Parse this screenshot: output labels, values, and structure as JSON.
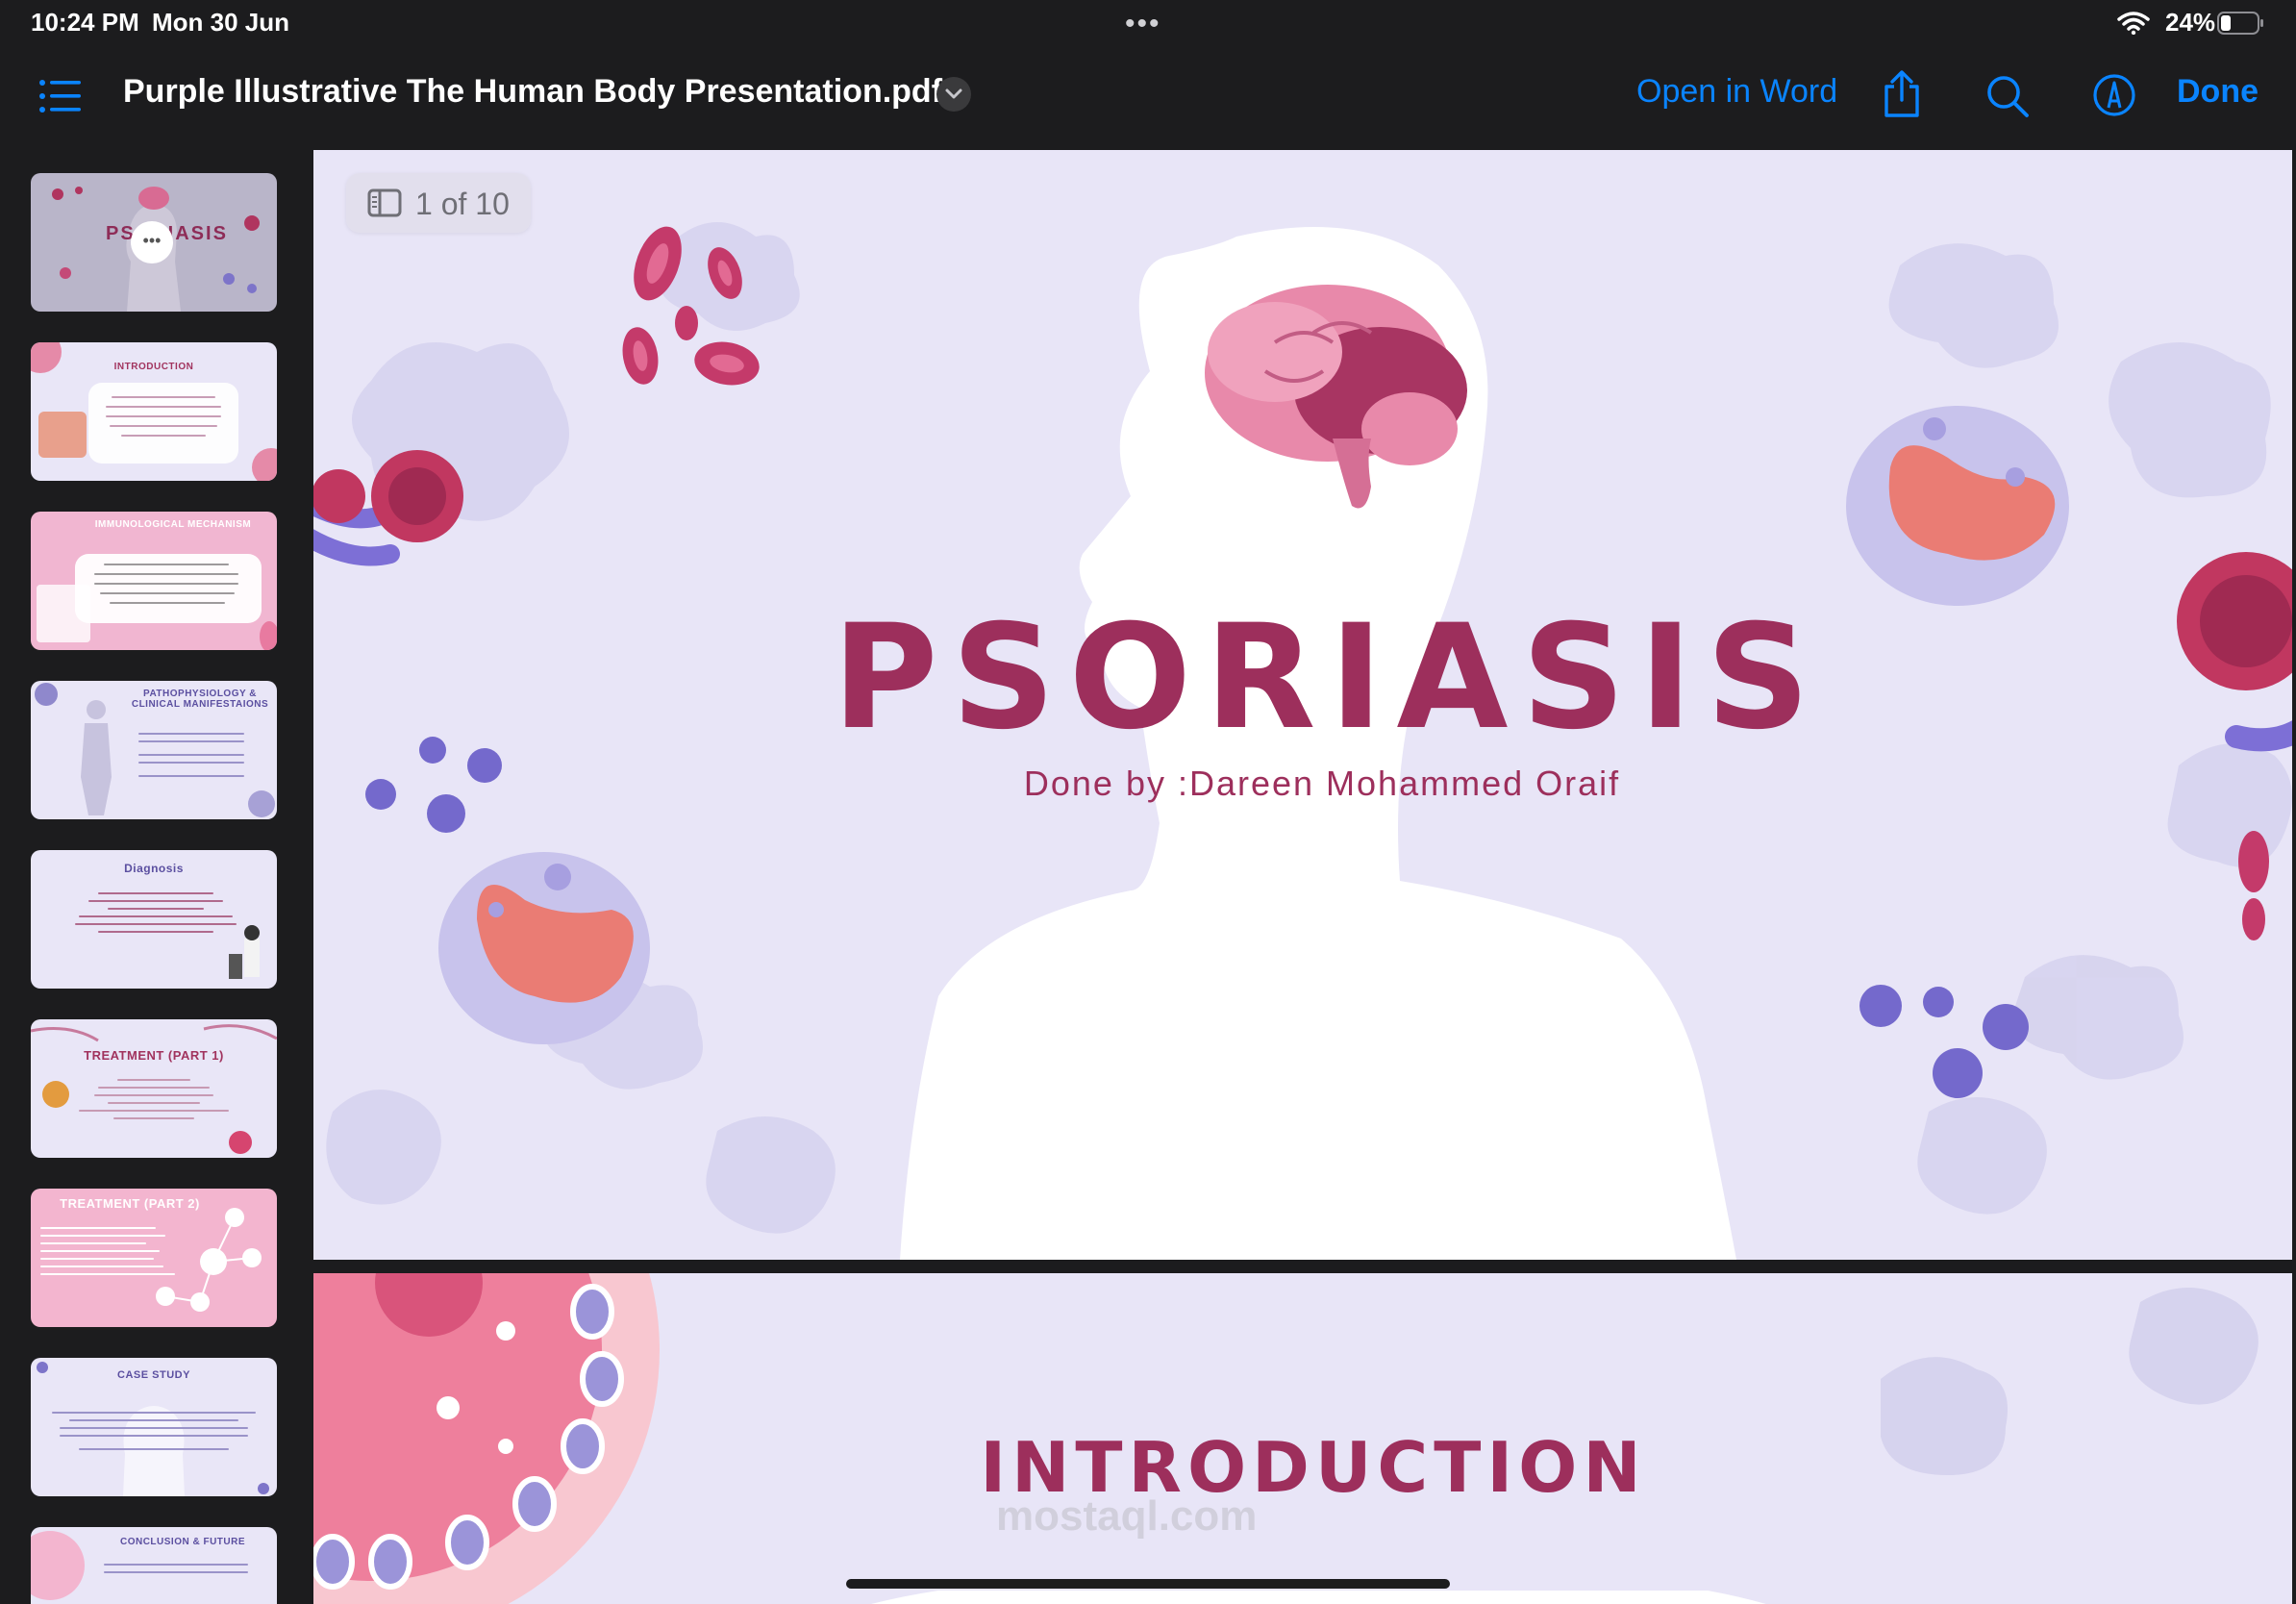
{
  "status_bar": {
    "time": "10:24 PM",
    "date": "Mon 30 Jun",
    "dots": "•••",
    "battery": "24%"
  },
  "toolbar": {
    "title": "Purple Illustrative The Human Body Presentation.pdf",
    "open_in_word": "Open in Word",
    "done": "Done",
    "icons": [
      "list-icon",
      "chevron-down-icon",
      "share-icon",
      "search-icon",
      "markup-icon"
    ]
  },
  "sidebar": {
    "thumbnails": [
      {
        "title": "PSORIASIS",
        "overlay": "•••"
      },
      {
        "title": "INTRODUCTION"
      },
      {
        "title": "IMMUNOLOGICAL MECHANISM"
      },
      {
        "title": "PATHOPHYSIOLOGY & CLINICAL MANIFESTAIONS"
      },
      {
        "title": "Diagnosis"
      },
      {
        "title": "TREATMENT (PART 1)"
      },
      {
        "title": "TREATMENT (PART 2)"
      },
      {
        "title": "CASE STUDY"
      },
      {
        "title": "CONCLUSION & FUTURE"
      }
    ]
  },
  "viewer": {
    "page_indicator": "1 of 10",
    "slide1": {
      "title": "PSORIASIS",
      "subtitle": "Done by :Dareen Mohammed Oraif"
    },
    "slide2": {
      "title": "INTRODUCTION",
      "watermark": "mostaql.com"
    }
  },
  "colors": {
    "accent": "#0a84ff",
    "slide_bg": "#e8e5f7",
    "title_magenta": "#9d2f5c",
    "chrome_bg": "#1c1c1e"
  }
}
